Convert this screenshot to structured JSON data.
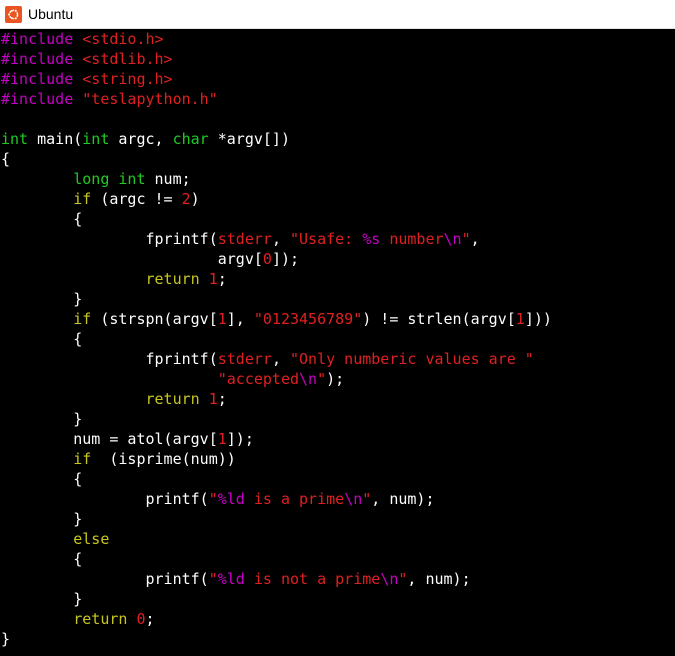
{
  "window": {
    "title": "Ubuntu",
    "icon": "ubuntu-logo-icon",
    "accent": "#E95420"
  },
  "terminal": {
    "colors": {
      "background": "#000000",
      "default": "#ffffff",
      "preproc": "#c400c4",
      "string": "#e02020",
      "type": "#22c922",
      "keyword": "#c8c61e",
      "number": "#e02020",
      "special": "#c400c4"
    },
    "lines": [
      [
        [
          "preproc",
          "#include "
        ],
        [
          "string",
          "<stdio.h>"
        ]
      ],
      [
        [
          "preproc",
          "#include "
        ],
        [
          "string",
          "<stdlib.h>"
        ]
      ],
      [
        [
          "preproc",
          "#include "
        ],
        [
          "string",
          "<string.h>"
        ]
      ],
      [
        [
          "preproc",
          "#include "
        ],
        [
          "string",
          "\"teslapython.h\""
        ]
      ],
      [],
      [
        [
          "type",
          "int"
        ],
        [
          "default",
          " main("
        ],
        [
          "type",
          "int"
        ],
        [
          "default",
          " argc, "
        ],
        [
          "type",
          "char"
        ],
        [
          "default",
          " *argv[])"
        ]
      ],
      [
        [
          "default",
          "{"
        ]
      ],
      [
        [
          "default",
          "        "
        ],
        [
          "type",
          "long"
        ],
        [
          "default",
          " "
        ],
        [
          "type",
          "int"
        ],
        [
          "default",
          " num;"
        ]
      ],
      [
        [
          "default",
          "        "
        ],
        [
          "keyword",
          "if"
        ],
        [
          "default",
          " (argc != "
        ],
        [
          "number",
          "2"
        ],
        [
          "default",
          ")"
        ]
      ],
      [
        [
          "default",
          "        {"
        ]
      ],
      [
        [
          "default",
          "                fprintf("
        ],
        [
          "string",
          "stderr"
        ],
        [
          "default",
          ", "
        ],
        [
          "string",
          "\"Usafe: "
        ],
        [
          "special",
          "%s"
        ],
        [
          "string",
          " number"
        ],
        [
          "special",
          "\\n"
        ],
        [
          "string",
          "\""
        ],
        [
          "default",
          ","
        ]
      ],
      [
        [
          "default",
          "                        argv["
        ],
        [
          "number",
          "0"
        ],
        [
          "default",
          "]);"
        ]
      ],
      [
        [
          "default",
          "                "
        ],
        [
          "keyword",
          "return"
        ],
        [
          "default",
          " "
        ],
        [
          "number",
          "1"
        ],
        [
          "default",
          ";"
        ]
      ],
      [
        [
          "default",
          "        }"
        ]
      ],
      [
        [
          "default",
          "        "
        ],
        [
          "keyword",
          "if"
        ],
        [
          "default",
          " (strspn(argv["
        ],
        [
          "number",
          "1"
        ],
        [
          "default",
          "], "
        ],
        [
          "string",
          "\"0123456789\""
        ],
        [
          "default",
          ") != strlen(argv["
        ],
        [
          "number",
          "1"
        ],
        [
          "default",
          "]))"
        ]
      ],
      [
        [
          "default",
          "        {"
        ]
      ],
      [
        [
          "default",
          "                fprintf("
        ],
        [
          "string",
          "stderr"
        ],
        [
          "default",
          ", "
        ],
        [
          "string",
          "\"Only numberic values are \""
        ]
      ],
      [
        [
          "default",
          "                        "
        ],
        [
          "string",
          "\"accepted"
        ],
        [
          "special",
          "\\n"
        ],
        [
          "string",
          "\""
        ],
        [
          "default",
          ");"
        ]
      ],
      [
        [
          "default",
          "                "
        ],
        [
          "keyword",
          "return"
        ],
        [
          "default",
          " "
        ],
        [
          "number",
          "1"
        ],
        [
          "default",
          ";"
        ]
      ],
      [
        [
          "default",
          "        }"
        ]
      ],
      [
        [
          "default",
          "        num = atol(argv["
        ],
        [
          "number",
          "1"
        ],
        [
          "default",
          "]);"
        ]
      ],
      [
        [
          "default",
          "        "
        ],
        [
          "keyword",
          "if"
        ],
        [
          "default",
          "  (isprime(num))"
        ]
      ],
      [
        [
          "default",
          "        {"
        ]
      ],
      [
        [
          "default",
          "                printf("
        ],
        [
          "string",
          "\""
        ],
        [
          "special",
          "%ld"
        ],
        [
          "string",
          " is a prime"
        ],
        [
          "special",
          "\\n"
        ],
        [
          "string",
          "\""
        ],
        [
          "default",
          ", num);"
        ]
      ],
      [
        [
          "default",
          "        }"
        ]
      ],
      [
        [
          "default",
          "        "
        ],
        [
          "keyword",
          "else"
        ]
      ],
      [
        [
          "default",
          "        {"
        ]
      ],
      [
        [
          "default",
          "                printf("
        ],
        [
          "string",
          "\""
        ],
        [
          "special",
          "%ld"
        ],
        [
          "string",
          " is not a prime"
        ],
        [
          "special",
          "\\n"
        ],
        [
          "string",
          "\""
        ],
        [
          "default",
          ", num);"
        ]
      ],
      [
        [
          "default",
          "        }"
        ]
      ],
      [
        [
          "default",
          "        "
        ],
        [
          "keyword",
          "return"
        ],
        [
          "default",
          " "
        ],
        [
          "number",
          "0"
        ],
        [
          "default",
          ";"
        ]
      ],
      [
        [
          "default",
          "}"
        ]
      ]
    ]
  }
}
